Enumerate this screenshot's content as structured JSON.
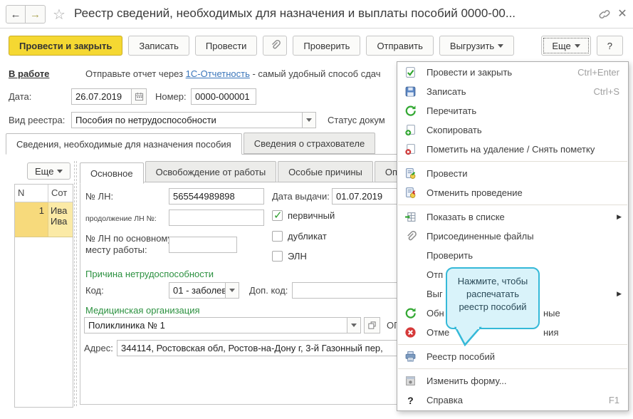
{
  "colors": {
    "accent": "#f5d832",
    "accent_border": "#c9ad25",
    "link": "#3a76bb",
    "heading_green": "#2c9140",
    "selection_yellow": "#f7da7c",
    "selection_yellow_light": "#fbeaa6",
    "tooltip_bg": "#d9f3fa",
    "tooltip_border": "#35b9d8"
  },
  "window": {
    "title": "Реестр сведений, необходимых для назначения и выплаты пособий 0000-00..."
  },
  "toolbar": {
    "buttons": [
      {
        "label": "Провести и закрыть",
        "primary": true
      },
      {
        "label": "Записать"
      },
      {
        "label": "Провести"
      },
      {
        "icon": "paperclip-icon"
      },
      {
        "label": "Проверить"
      },
      {
        "label": "Отправить"
      },
      {
        "label": "Выгрузить",
        "arrow": true
      },
      {
        "label": "Еще",
        "arrow": true,
        "focused": true,
        "push_right": true
      },
      {
        "label": "?"
      }
    ]
  },
  "status": {
    "state_link": "В работе",
    "message_prefix": "Отправьте отчет через ",
    "message_link": "1С-Отчетность",
    "message_suffix": " - самый удобный способ сдач"
  },
  "header_fields": {
    "date_label": "Дата:",
    "date_value": "26.07.2019",
    "number_label": "Номер:",
    "number_value": "0000-000001",
    "registry_type_label": "Вид реестра:",
    "registry_type_value": "Пособия по нетрудоспособности",
    "doc_status_label": "Статус докум"
  },
  "outer_tabs": {
    "active": 0,
    "items": [
      "Сведения, необходимые для назначения пособия",
      "Сведения о страхователе"
    ]
  },
  "panel": {
    "more_button": "Еще"
  },
  "inner_tabs": {
    "active": 0,
    "items": [
      "Основное",
      "Освобождение от работы",
      "Особые причины",
      "Опла"
    ]
  },
  "employees_table": {
    "columns": [
      "N",
      "Сот"
    ],
    "rows": [
      {
        "num": "1",
        "lines": [
          "Ива",
          "Ива"
        ]
      }
    ]
  },
  "form": {
    "ln_label": "№ ЛН:",
    "ln_value": "565544989898",
    "issue_date_label": "Дата выдачи:",
    "issue_date_value": "01.07.2019",
    "continuation_label": "продолжение ЛН №:",
    "continuation_value": "",
    "primary_checkbox_label": "первичный",
    "primary_checked": true,
    "ln_main_label_line1": "№ ЛН по основному",
    "ln_main_label_line2": "месту работы:",
    "ln_main_value": "",
    "duplicate_checkbox_label": "дубликат",
    "duplicate_checked": false,
    "eln_checkbox_label": "ЭЛН",
    "eln_checked": false,
    "disability_heading": "Причина нетрудоспособности",
    "code_label": "Код:",
    "code_value": "01 - заболев",
    "addcode_label": "Доп. код:",
    "addcode_value": "",
    "med_org_heading": "Медицинская организация",
    "med_org_value": "Поликлиника № 1",
    "ogrn_fragment": "ОГ",
    "address_label": "Адрес:",
    "address_value": "344114, Ростовская обл, Ростов-на-Дону г, 3-й Газонный пер,"
  },
  "menu": {
    "items": [
      {
        "icon": "post-close-icon",
        "label": "Провести и закрыть",
        "shortcut": "Ctrl+Enter"
      },
      {
        "icon": "save-icon",
        "label": "Записать",
        "shortcut": "Ctrl+S"
      },
      {
        "icon": "refresh-icon",
        "label": "Перечитать"
      },
      {
        "icon": "copy-icon",
        "label": "Скопировать"
      },
      {
        "icon": "mark-delete-icon",
        "label": "Пометить на удаление / Снять пометку",
        "separator_after": true
      },
      {
        "icon": "post-icon",
        "label": "Провести"
      },
      {
        "icon": "unpost-icon",
        "label": "Отменить проведение",
        "separator_after": true
      },
      {
        "icon": "show-list-icon",
        "label": "Показать в списке",
        "submenu": true
      },
      {
        "icon": "attach-icon",
        "label": "Присоединенные файлы"
      },
      {
        "label": "Проверить"
      },
      {
        "label": "Отп"
      },
      {
        "label": "Выг",
        "submenu": true
      },
      {
        "icon": "refresh-icon",
        "label": "Обн",
        "label_right": "ные"
      },
      {
        "icon": "cancel-icon",
        "label": "Отме",
        "label_right": "ния",
        "separator_after": true
      },
      {
        "icon": "print-icon",
        "label": "Реестр пособий",
        "separator_after": true
      },
      {
        "icon": "edit-form-icon",
        "label": "Изменить форму..."
      },
      {
        "icon": "help-icon",
        "label": "Справка",
        "shortcut": "F1"
      }
    ]
  },
  "tooltip": {
    "lines": [
      "Нажмите, чтобы",
      "распечатать",
      "реестр пособий"
    ]
  }
}
